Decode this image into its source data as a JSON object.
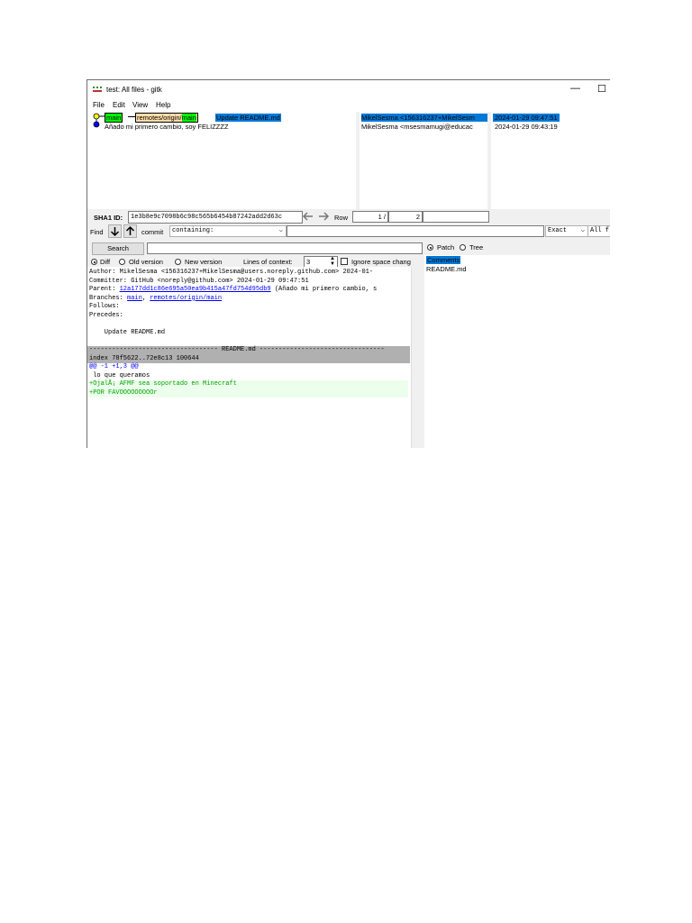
{
  "window": {
    "title": "test: All files - gitk",
    "minimize_glyph": "—",
    "maximize_glyph": "☐"
  },
  "menu": {
    "file": "File",
    "edit": "Edit",
    "view": "View",
    "help": "Help"
  },
  "commits": [
    {
      "refs": {
        "local": "main",
        "remote_prefix": "remotes/origin/",
        "remote_branch": "main"
      },
      "subject": "Update README.md",
      "author": "MikelSesma <156316237+MikelSesm",
      "date": "2024-01-29 09:47:51"
    },
    {
      "subject": "Añado mi primero cambio, soy FELIZZZZ",
      "author": "MikelSesma <msesmamugi@educac",
      "date": "2024-01-29 09:43:19"
    }
  ],
  "sha": {
    "label": "SHA1 ID:",
    "value": "1e3b8e9c7098b6c98c565b6454b87242add2d63c",
    "row_label": "Row",
    "row_current": "1 /",
    "row_total": "2"
  },
  "find": {
    "label": "Find",
    "type": "commit",
    "mode": "containing:",
    "match": "Exact",
    "fields": "All f"
  },
  "search": {
    "button": "Search"
  },
  "diffopts": {
    "diff": "Diff",
    "old": "Old version",
    "new": "New version",
    "context_label": "Lines of context:",
    "context_value": "3",
    "ignore_ws": "Ignore space chang"
  },
  "patchtree": {
    "patch": "Patch",
    "tree": "Tree"
  },
  "files": {
    "comments": "Comments",
    "items": [
      "README.md"
    ]
  },
  "details": {
    "author": "Author: MikelSesma <156316237+MikelSesma@users.noreply.github.com>  2024-01-",
    "committer": "Committer: GitHub <noreply@github.com>  2024-01-29 09:47:51",
    "parent_label": "Parent: ",
    "parent_sha": "12a177dd1c86e695a50ea9b415a47fd754d95db9",
    "parent_desc": " (Añado mi primero cambio, s",
    "branches_label": "Branches: ",
    "branch1": "main",
    "branch_sep": ", ",
    "branch2": "remotes/origin/main",
    "follows": "Follows:",
    "precedes": "Precedes:",
    "message": "    Update README.md"
  },
  "diff": {
    "file_header": "---------------------------------- README.md ---------------------------------",
    "index": "index 78f5622..72e8c13 100644",
    "hunk": "@@ -1 +1,3 @@",
    "context": " lo que queramos",
    "added": [
      "+OjalÃ¡ AFMF sea soportado en Minecraft",
      "+POR FAVOOOOOOOOOr"
    ]
  }
}
